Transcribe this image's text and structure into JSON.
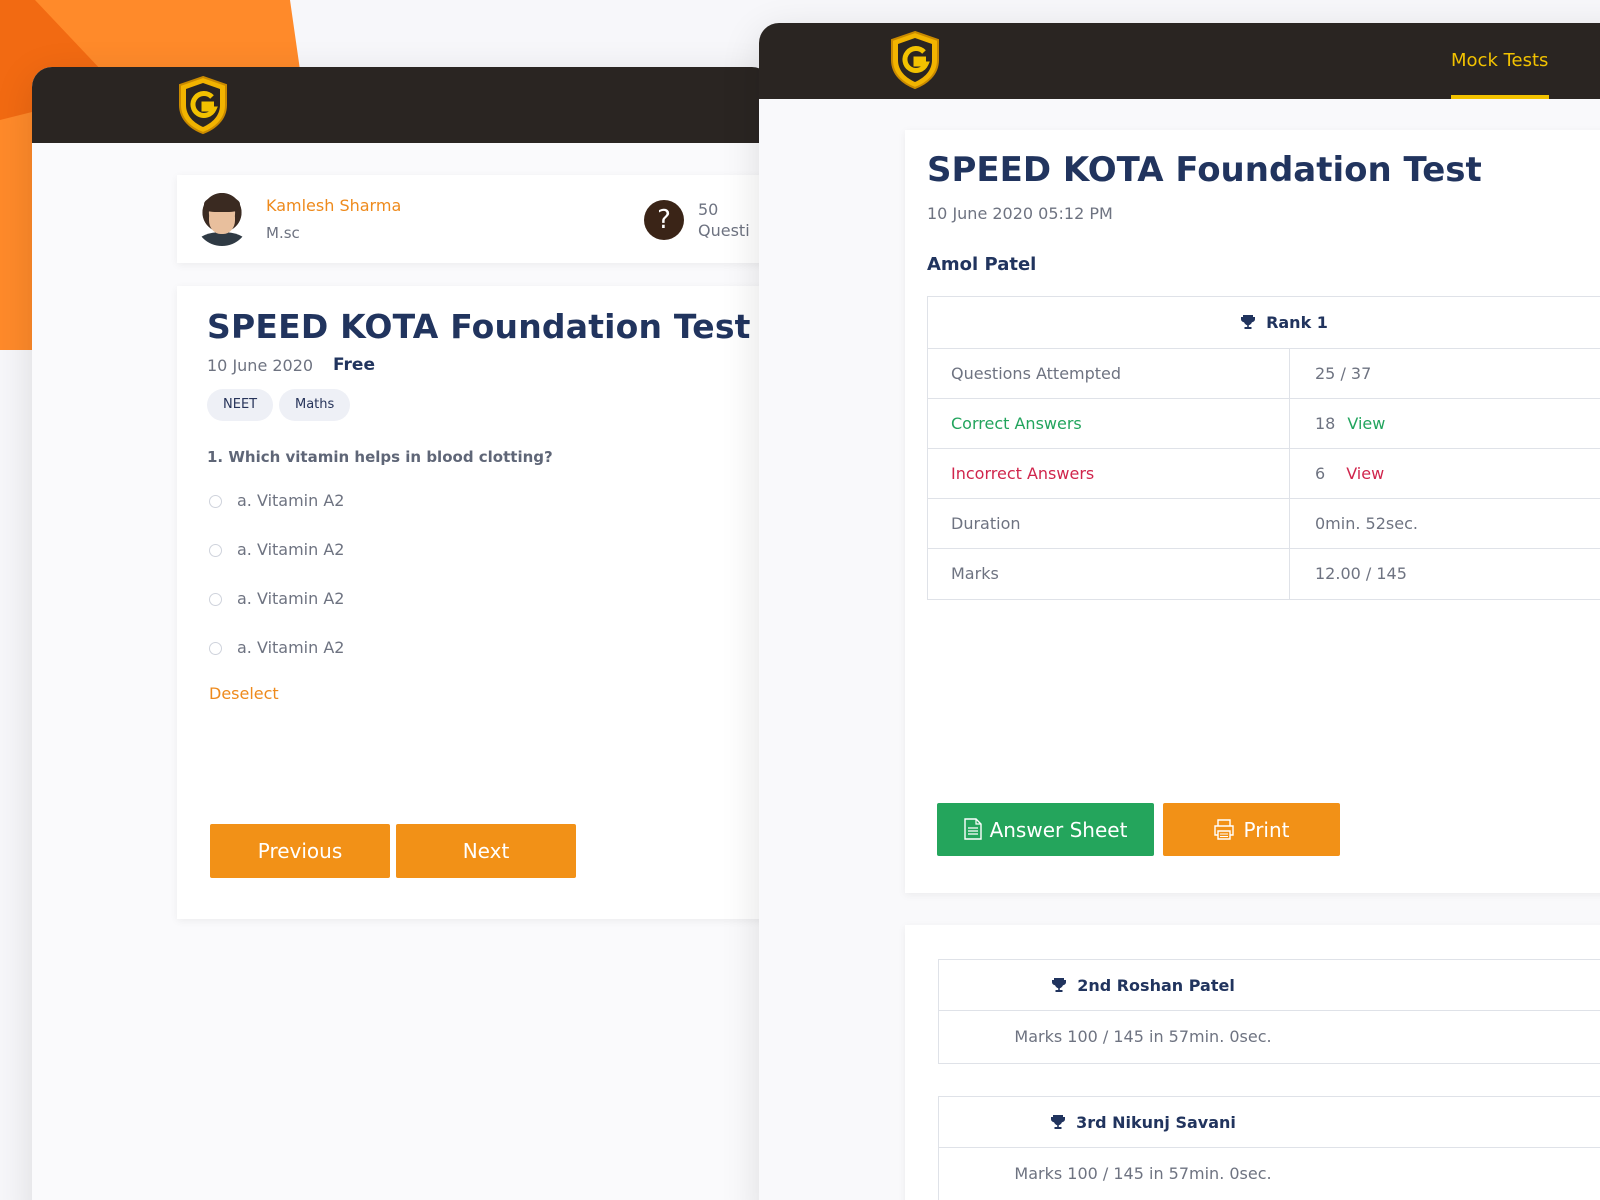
{
  "quiz": {
    "author": {
      "name": "Kamlesh Sharma",
      "degree": "M.sc"
    },
    "questions_count": "50",
    "questions_label": "Questi",
    "title": "SPEED KOTA  Foundation Test",
    "date": "10 June 2020",
    "price": "Free",
    "tags": [
      "NEET",
      "Maths"
    ],
    "question": "1. Which vitamin helps in blood clotting?",
    "options": [
      "a.  Vitamin A2",
      "a.  Vitamin A2",
      "a.  Vitamin A2",
      "a.  Vitamin A2"
    ],
    "deselect": "Deselect",
    "previous": "Previous",
    "next": "Next"
  },
  "results": {
    "nav_item": "Mock Tests",
    "title": "SPEED KOTA  Foundation Test",
    "datetime": "10 June 2020    05:12 PM",
    "student": "Amol Patel",
    "rank": "Rank 1",
    "rows": [
      {
        "label": "Questions Attempted",
        "value": "25 / 37",
        "link": ""
      },
      {
        "label": "Correct Answers",
        "value": "18",
        "link": "View"
      },
      {
        "label": "Incorrect Answers",
        "value": "6",
        "link": "View"
      },
      {
        "label": "Duration",
        "value": "0min. 52sec.",
        "link": ""
      },
      {
        "label": "Marks",
        "value": "12.00 / 145",
        "link": ""
      }
    ],
    "answer_sheet": "Answer Sheet",
    "print": "Print"
  },
  "leaderboard": [
    {
      "title": "2nd Roshan Patel",
      "detail": "Marks 100 / 145 in 57min. 0sec."
    },
    {
      "title": "3rd Nikunj Savani",
      "detail": "Marks 100 / 145 in 57min. 0sec."
    }
  ],
  "colors": {
    "accent_orange": "#f29117",
    "nav_gold": "#f2c200",
    "correct_green": "#22a45d",
    "incorrect_red": "#d0254c",
    "title_navy": "#21345e",
    "topbar": "#2a2522"
  },
  "icons": [
    "shield-logo-icon",
    "question-icon",
    "trophy-icon",
    "document-icon",
    "printer-icon"
  ]
}
